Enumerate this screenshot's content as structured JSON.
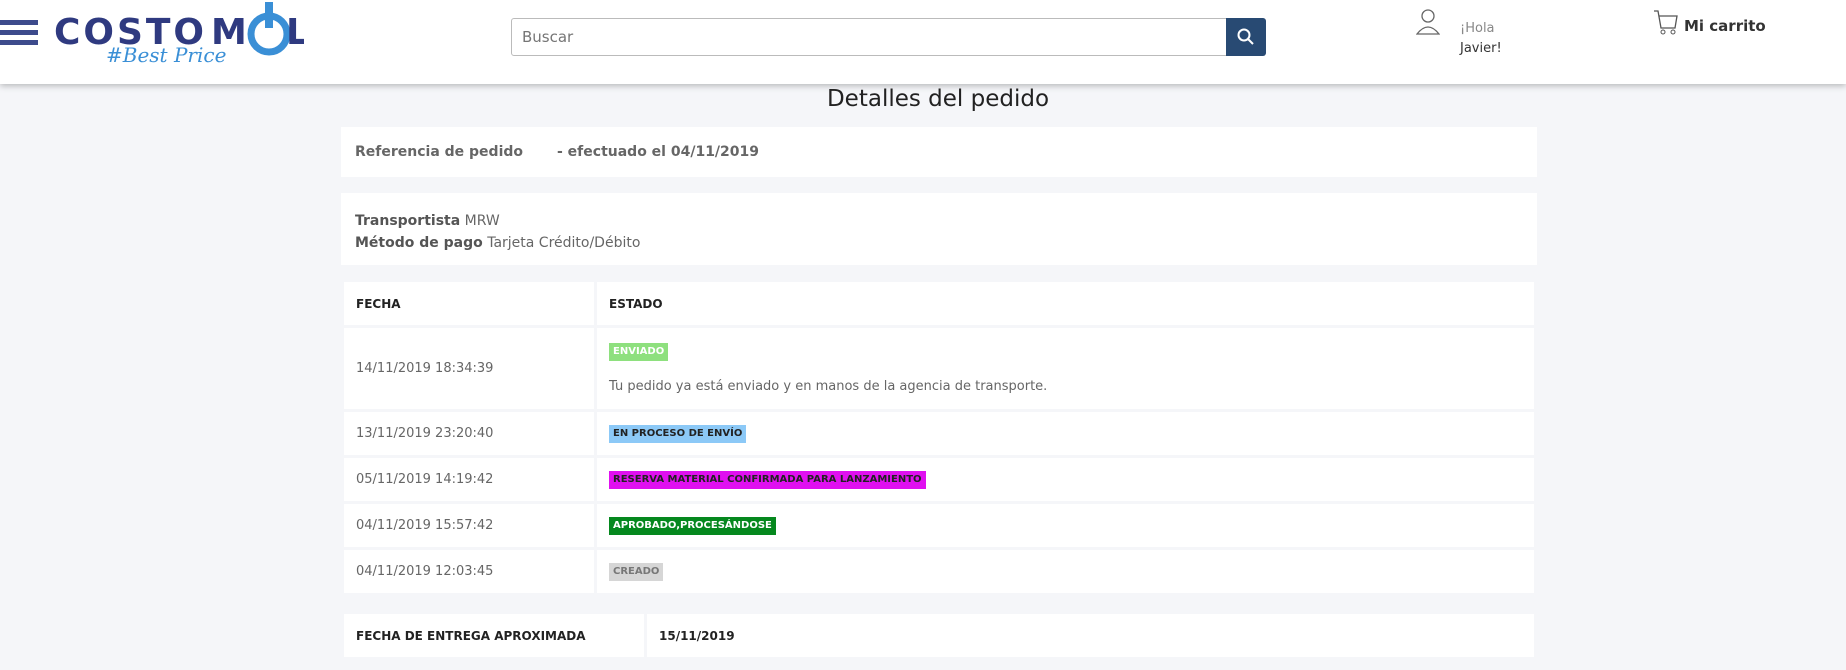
{
  "header": {
    "logo_text": "COSTO MOVIL",
    "logo_tagline": "#Best Price",
    "search_placeholder": "Buscar",
    "greeting": "¡Hola",
    "user_name": "Javier!",
    "cart_label": "Mi carrito",
    "brand_color": "#3d4b8c",
    "search_button_color": "#284a73"
  },
  "page": {
    "title": "Detalles del pedido"
  },
  "order": {
    "reference_label": "Referencia de pedido",
    "placed_text": "- efectuado el 04/11/2019",
    "carrier_label": "Transportista",
    "carrier": "MRW",
    "payment_label": "Método de pago",
    "payment": "Tarjeta Crédito/Débito"
  },
  "history": {
    "col_date": "FECHA",
    "col_status": "ESTADO",
    "rows": [
      {
        "date": "14/11/2019 18:34:39",
        "status": "ENVIADO",
        "color": "#8ee07e",
        "text_color": "#ffffff",
        "note": "Tu pedido ya está enviado y en manos de la agencia de transporte."
      },
      {
        "date": "13/11/2019 23:20:40",
        "status": "EN PROCESO DE ENVÍO",
        "color": "#8cc9f7",
        "text_color": "#222222"
      },
      {
        "date": "05/11/2019 14:19:42",
        "status": "RESERVA MATERIAL CONFIRMADA PARA LANZAMIENTO",
        "color": "#e010f0",
        "text_color": "#222222"
      },
      {
        "date": "04/11/2019 15:57:42",
        "status": "APROBADO,PROCESÁNDOSE",
        "color": "#05881e",
        "text_color": "#ffffff"
      },
      {
        "date": "04/11/2019 12:03:45",
        "status": "CREADO",
        "color": "#d6d6d6",
        "text_color": "#777777"
      }
    ]
  },
  "delivery": {
    "label": "FECHA DE ENTREGA APROXIMADA",
    "date": "15/11/2019"
  }
}
